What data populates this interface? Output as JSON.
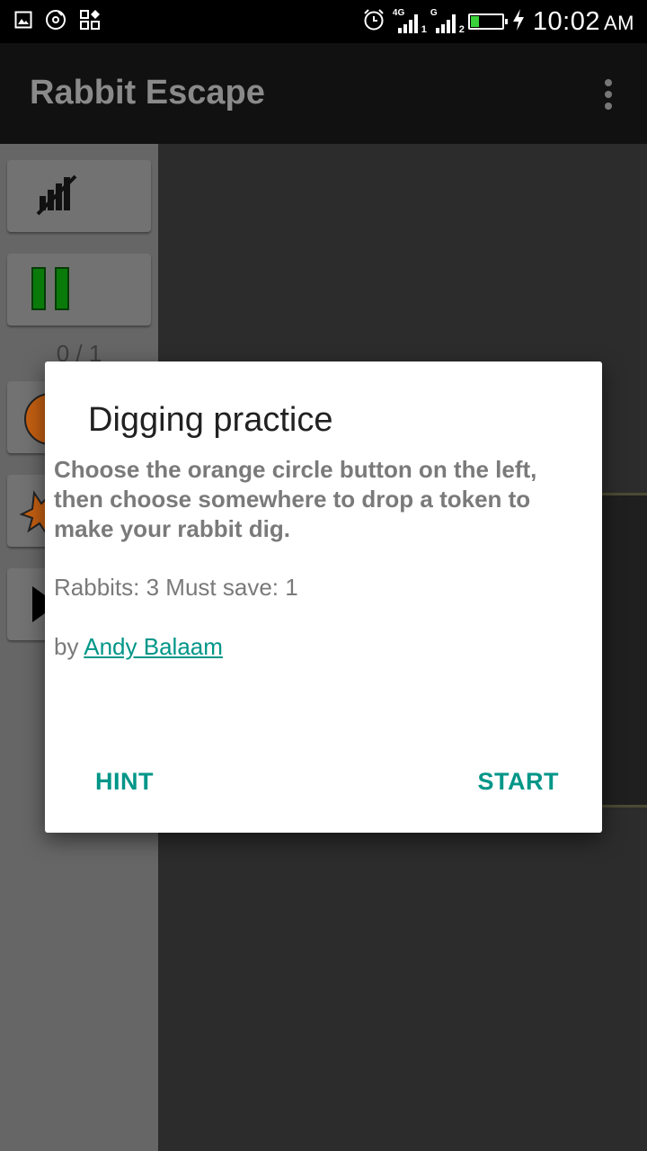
{
  "status_bar": {
    "time": "10:02",
    "ampm": "AM",
    "network_1": "4G",
    "sim_1": "1",
    "network_2": "G",
    "sim_2": "2",
    "icons": [
      "gallery-icon",
      "music-icon",
      "apps-icon",
      "alarm-icon",
      "signal-icon",
      "battery-icon",
      "charging-icon"
    ],
    "battery_level": 0.25
  },
  "app_bar": {
    "title": "Rabbit Escape"
  },
  "sidebar": {
    "counter": "0 / 1"
  },
  "dialog": {
    "title": "Digging practice",
    "description": "Choose the orange circle button on the left, then choose somewhere to drop a token to make your rabbit dig.",
    "stats": "Rabbits: 3 Must save: 1",
    "author_prefix": "by ",
    "author_name": "Andy Balaam",
    "hint_label": "HINT",
    "start_label": "START"
  },
  "colors": {
    "accent": "#009688",
    "app_bar": "#111111",
    "sidebar": "#666666",
    "game_bg": "#2c2c2c"
  }
}
